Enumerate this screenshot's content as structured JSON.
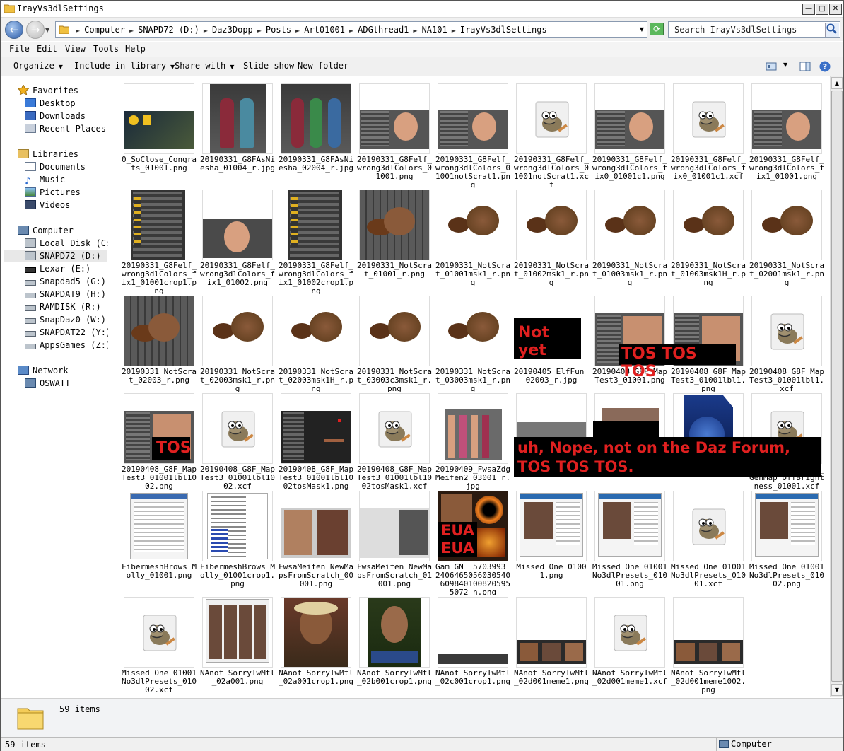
{
  "window": {
    "title": "IrayVs3dlSettings",
    "minimize": "—",
    "maximize": "□",
    "close": "✕"
  },
  "address": {
    "crumbs": [
      "Computer",
      "SNAPD72 (D:)",
      "Daz3Dopp",
      "Posts",
      "Art01001",
      "ADGthread1",
      "NA101",
      "IrayVs3dlSettings"
    ],
    "search_placeholder": "Search IrayVs3dlSettings"
  },
  "menu": [
    "File",
    "Edit",
    "View",
    "Tools",
    "Help"
  ],
  "toolbar": {
    "organize": "Organize",
    "include": "Include in library",
    "share": "Share with",
    "slideshow": "Slide show",
    "newfolder": "New folder"
  },
  "sidebar": {
    "favorites": {
      "label": "Favorites",
      "items": [
        "Desktop",
        "Downloads",
        "Recent Places"
      ]
    },
    "libraries": {
      "label": "Libraries",
      "items": [
        "Documents",
        "Music",
        "Pictures",
        "Videos"
      ]
    },
    "computer": {
      "label": "Computer",
      "items": [
        "Local Disk (C:)",
        "SNAPD72 (D:)",
        "Lexar (E:)",
        "Snapdad5 (G:)",
        "SNAPDAT9 (H:)",
        "RAMDISK (R:)",
        "SnapDaz0 (W:)",
        "SNAPDAT22 (Y:)",
        "AppsGames (Z:)"
      ]
    },
    "network": {
      "label": "Network",
      "items": [
        "OSWATT"
      ]
    }
  },
  "files": [
    {
      "name": "0_SoClose_Congrats_01001.png",
      "thumb": "wide-dark"
    },
    {
      "name": "20190331_G8FAsNiesha_01004_r.jpg",
      "thumb": "figures2"
    },
    {
      "name": "20190331_G8FAsNiesha_02004_r.jpg",
      "thumb": "figures3"
    },
    {
      "name": "20190331_G8Felf_wrong3dlColors_01001.png",
      "thumb": "ui-head"
    },
    {
      "name": "20190331_G8Felf_wrong3dlColors_01001notScrat1.png",
      "thumb": "ui-head"
    },
    {
      "name": "20190331_G8Felf_wrong3dlColors_01001notScrat1.xcf",
      "thumb": "gimp"
    },
    {
      "name": "20190331_G8Felf_wrong3dlColors_fix0_01001c1.png",
      "thumb": "ui-head"
    },
    {
      "name": "20190331_G8Felf_wrong3dlColors_fix0_01001c1.xcf",
      "thumb": "gimp"
    },
    {
      "name": "20190331_G8Felf_wrong3dlColors_fix1_01001.png",
      "thumb": "ui-head"
    },
    {
      "name": "20190331_G8Felf_wrong3dlColors_fix1_01001crop1.png",
      "thumb": "ui-tall"
    },
    {
      "name": "20190331_G8Felf_wrong3dlColors_fix1_01002.png",
      "thumb": "head-wide"
    },
    {
      "name": "20190331_G8Felf_wrong3dlColors_fix1_01002crop1.png",
      "thumb": "ui-tall"
    },
    {
      "name": "20190331_NotScrat_01001_r.png",
      "thumb": "squirrel-room"
    },
    {
      "name": "20190331_NotScrat_01001msk1_r.png",
      "thumb": "squirrel"
    },
    {
      "name": "20190331_NotScrat_01002msk1_r.png",
      "thumb": "squirrel"
    },
    {
      "name": "20190331_NotScrat_01003msk1_r.png",
      "thumb": "squirrel"
    },
    {
      "name": "20190331_NotScrat_01003msk1H_r.png",
      "thumb": "squirrel"
    },
    {
      "name": "20190331_NotScrat_02001msk1_r.png",
      "thumb": "squirrel"
    },
    {
      "name": "20190331_NotScrat_02003_r.png",
      "thumb": "squirrel-room"
    },
    {
      "name": "20190331_NotScrat_02003msk1_r.png",
      "thumb": "squirrel"
    },
    {
      "name": "20190331_NotScrat_02003msk1H_r.png",
      "thumb": "squirrel"
    },
    {
      "name": "20190331_NotScrat_03003c3msk1_r.png",
      "thumb": "squirrel"
    },
    {
      "name": "20190331_NotScrat_03003msk1_r.png",
      "thumb": "squirrel"
    },
    {
      "name": "20190405_ElfFun_02003_r.jpg",
      "thumb": "blank"
    },
    {
      "name": "20190408_G8F_MapTest3_01001.png",
      "thumb": "ui-skin"
    },
    {
      "name": "20190408_G8F_MapTest3_01001lbl1.png",
      "thumb": "ui-skin"
    },
    {
      "name": "20190408_G8F_MapTest3_01001lbl1.xcf",
      "thumb": "gimp"
    },
    {
      "name": "20190408_G8F_MapTest3_01001lbl1002.png",
      "thumb": "ui-skin"
    },
    {
      "name": "20190408_G8F_MapTest3_01001lbl1002.xcf",
      "thumb": "gimp"
    },
    {
      "name": "20190408_G8F_MapTest3_01001lbl1002tosMask1.png",
      "thumb": "ui-dark"
    },
    {
      "name": "20190408_G8F_MapTest3_01001lbl1002tosMask1.xcf",
      "thumb": "gimp"
    },
    {
      "name": "20190409_FwsaZdgMeifen2_03001_r.jpg",
      "thumb": "figures-many"
    },
    {
      "name": "g",
      "thumb": "ui-strip"
    },
    {
      "name": "png",
      "thumb": "figures-small"
    },
    {
      "name": "htness_01001.png",
      "thumb": "blue-doc"
    },
    {
      "name": "DarkMerchSet_1k_GenMap_OffBrightness_01001.xcf",
      "thumb": "gimp"
    },
    {
      "name": "FibermeshBrows_Molly_01001.png",
      "thumb": "webpage"
    },
    {
      "name": "FibermeshBrows_Molly_01001crop1.png",
      "thumb": "doc-list"
    },
    {
      "name": "FwsaMeifen_NewMapsFromScratch_00001.png",
      "thumb": "portraits"
    },
    {
      "name": "FwsaMeifen_NewMapsFromScratch_01001.png",
      "thumb": "eua"
    },
    {
      "name": "Gam_GN__5703993_2406465056030540_6098401008205955072_n.png",
      "thumb": "eye-fire"
    },
    {
      "name": "Missed_One_01001.png",
      "thumb": "webpage-face"
    },
    {
      "name": "Missed_One_01001No3dlPresets_01001.png",
      "thumb": "webpage-face"
    },
    {
      "name": "Missed_One_01001No3dlPresets_01001.xcf",
      "thumb": "gimp"
    },
    {
      "name": "Missed_One_01001No3dlPresets_01002.png",
      "thumb": "webpage-face"
    },
    {
      "name": "Missed_One_01001No3dlPresets_01002.xcf",
      "thumb": "gimp"
    },
    {
      "name": "NAnot_SorryTwMtl_02a001.png",
      "thumb": "gallery"
    },
    {
      "name": "NAnot_SorryTwMtl_02a001crop1.png",
      "thumb": "portrait-warm"
    },
    {
      "name": "NAnot_SorryTwMtl_02b001crop1.png",
      "thumb": "portrait-green"
    },
    {
      "name": "NAnot_SorryTwMtl_02c001crop1.png",
      "thumb": "strip-dark"
    },
    {
      "name": "NAnot_SorryTwMtl_02d001meme1.png",
      "thumb": "meme"
    },
    {
      "name": "NAnot_SorryTwMtl_02d001meme1.xcf",
      "thumb": "gimp"
    },
    {
      "name": "NAnot_SorryTwMtl_02d001meme1002.png",
      "thumb": "meme"
    }
  ],
  "overlays": {
    "not_yet": "Not yet",
    "tos_row": "TOS TOS TOS",
    "tos_single": "TOS",
    "nope_line1": "uh, Nope, not on the Daz Forum,",
    "nope_line2": "TOS TOS TOS.",
    "eua1": "EUA",
    "eua2": "EUA"
  },
  "details": {
    "count": "59 items"
  },
  "status": {
    "left": "59 items",
    "right": "Computer"
  },
  "colors": {
    "overlay_bg": "#000000",
    "overlay_text": "#e02020",
    "accent": "#2a5aa8"
  }
}
